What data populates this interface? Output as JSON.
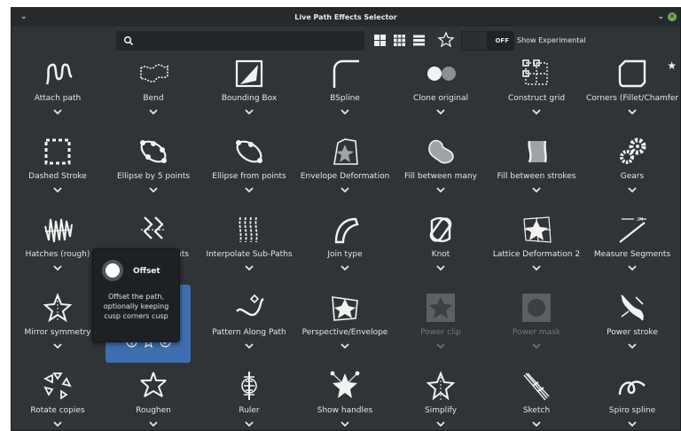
{
  "window": {
    "title": "Live Path Effects Selector",
    "menu_glyph": "⌄",
    "minimize_glyph": "⌄",
    "close_glyph": "✕"
  },
  "toolbar": {
    "search": {
      "placeholder": "",
      "value": ""
    },
    "view_modes": [
      "grid-large-icon",
      "grid-small-icon",
      "list-icon"
    ],
    "favorites_icon": "star-outline-icon",
    "experimental_switch": {
      "state": "OFF"
    },
    "experimental_label": "Show Experimental"
  },
  "effects": [
    {
      "label": "Attach path",
      "icon": "attach-path-icon"
    },
    {
      "label": "Bend",
      "icon": "bend-icon"
    },
    {
      "label": "Bounding Box",
      "icon": "bounding-box-icon"
    },
    {
      "label": "BSpline",
      "icon": "bspline-icon"
    },
    {
      "label": "Clone original",
      "icon": "clone-original-icon"
    },
    {
      "label": "Construct grid",
      "icon": "construct-grid-icon"
    },
    {
      "label": "Corners (Fillet/Chamfer)",
      "icon": "corners-icon",
      "favorite": true
    },
    {
      "label": "Dashed Stroke",
      "icon": "dashed-stroke-icon"
    },
    {
      "label": "Ellipse by 5 points",
      "icon": "ellipse-5-points-icon"
    },
    {
      "label": "Ellipse from points",
      "icon": "ellipse-from-points-icon"
    },
    {
      "label": "Envelope Deformation",
      "icon": "envelope-deformation-icon"
    },
    {
      "label": "Fill between many",
      "icon": "fill-between-many-icon"
    },
    {
      "label": "Fill between strokes",
      "icon": "fill-between-strokes-icon"
    },
    {
      "label": "Gears",
      "icon": "gears-icon"
    },
    {
      "label": "Hatches (rough)",
      "icon": "hatches-icon"
    },
    {
      "label": "Interpolate points",
      "icon": "interpolate-points-icon"
    },
    {
      "label": "Interpolate Sub-Paths",
      "icon": "interpolate-subpaths-icon"
    },
    {
      "label": "Join type",
      "icon": "join-type-icon"
    },
    {
      "label": "Knot",
      "icon": "knot-icon"
    },
    {
      "label": "Lattice Deformation 2",
      "icon": "lattice-deformation-icon"
    },
    {
      "label": "Measure Segments",
      "icon": "measure-segments-icon"
    },
    {
      "label": "Mirror symmetry",
      "icon": "mirror-symmetry-icon"
    },
    {
      "label": "Offset",
      "icon": "offset-icon",
      "selected": true
    },
    {
      "label": "Pattern Along Path",
      "icon": "pattern-along-path-icon"
    },
    {
      "label": "Perspective/Envelope",
      "icon": "perspective-envelope-icon"
    },
    {
      "label": "Power clip",
      "icon": "power-clip-icon",
      "disabled": true
    },
    {
      "label": "Power mask",
      "icon": "power-mask-icon",
      "disabled": true
    },
    {
      "label": "Power stroke",
      "icon": "power-stroke-icon"
    },
    {
      "label": "Rotate copies",
      "icon": "rotate-copies-icon"
    },
    {
      "label": "Roughen",
      "icon": "roughen-icon"
    },
    {
      "label": "Ruler",
      "icon": "ruler-icon"
    },
    {
      "label": "Show handles",
      "icon": "show-handles-icon"
    },
    {
      "label": "Simplify",
      "icon": "simplify-icon"
    },
    {
      "label": "Sketch",
      "icon": "sketch-icon"
    },
    {
      "label": "Spiro spline",
      "icon": "spiro-spline-icon"
    }
  ],
  "selected_actions": [
    "info-icon",
    "star-icon",
    "check-circle-icon"
  ],
  "tooltip": {
    "title": "Offset",
    "description": "Offset the path, optionally keeping cusp corners cusp"
  },
  "colors": {
    "window_bg": "#2f3437",
    "titlebar_bg": "#262a2c",
    "selection_bg": "#3d6fb0",
    "text": "#e4e6e7",
    "disabled_text": "#737a7d"
  }
}
